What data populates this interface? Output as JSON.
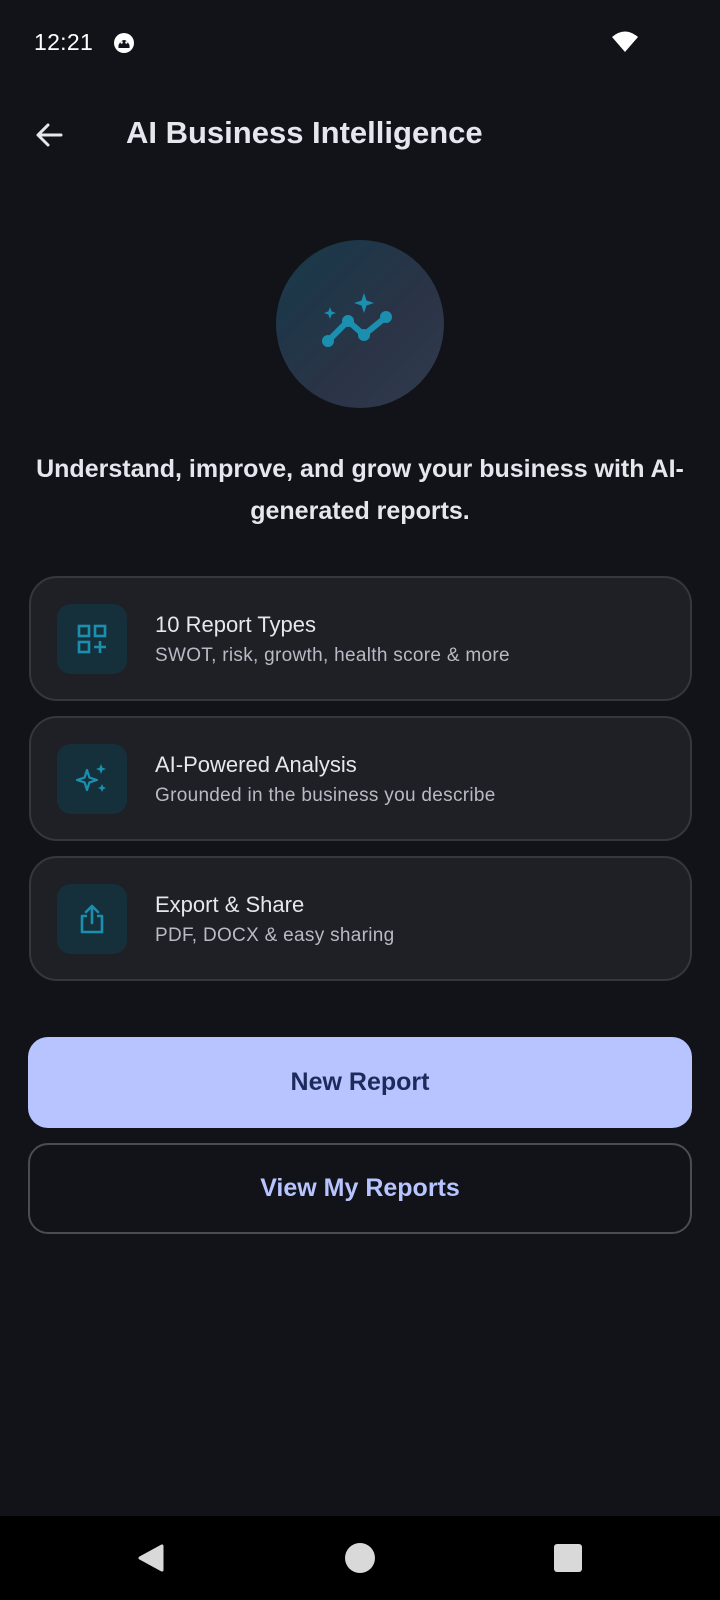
{
  "status_bar": {
    "time": "12:21",
    "notification_icon": "android-debug-icon",
    "wifi_icon": "wifi-icon"
  },
  "app_bar": {
    "back_icon": "arrow-back-icon",
    "title": "AI Business Intelligence"
  },
  "hero": {
    "icon": "sparkle-trend-icon",
    "tagline": "Understand, improve, and grow your business with AI-generated reports."
  },
  "features": [
    {
      "icon": "grid-add-icon",
      "title": "10 Report Types",
      "subtitle": "SWOT, risk, growth, health score & more"
    },
    {
      "icon": "sparkles-icon",
      "title": "AI-Powered Analysis",
      "subtitle": "Grounded in the business you describe"
    },
    {
      "icon": "share-upload-icon",
      "title": "Export & Share",
      "subtitle": "PDF, DOCX & easy sharing"
    }
  ],
  "actions": {
    "new_report": "New Report",
    "view_reports": "View My Reports"
  },
  "colors": {
    "background": "#121318",
    "card": "#1f2026",
    "accent_teal": "#1a8fb0",
    "primary_button": "#b7c4ff",
    "primary_button_text": "#1d2b5c"
  },
  "nav_bar": {
    "back": "nav-back-icon",
    "home": "nav-home-icon",
    "recents": "nav-recents-icon"
  }
}
